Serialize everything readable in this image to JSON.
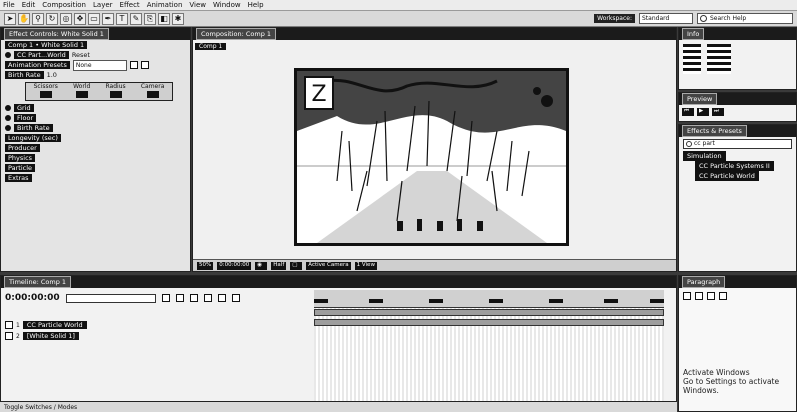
{
  "menu": [
    "File",
    "Edit",
    "Composition",
    "Layer",
    "Effect",
    "Animation",
    "View",
    "Window",
    "Help"
  ],
  "toolbar": {
    "workspace_label": "Workspace:",
    "workspace_value": "Standard",
    "search_placeholder": "Search Help"
  },
  "effects_panel": {
    "tab_label": "Effect Controls: White Solid 1",
    "breadcrumb": "Comp 1 • White Solid 1",
    "effect_name": "CC Part...World",
    "rows": [
      {
        "label": "Animation Presets",
        "value": "None"
      },
      {
        "label": "Birth Rate",
        "value": "1.0"
      }
    ],
    "params": [
      {
        "label": "Scissors"
      },
      {
        "label": "World"
      },
      {
        "label": "Radius"
      },
      {
        "label": "Camera"
      }
    ],
    "sections": [
      "Grid",
      "Floor",
      "Birth Rate",
      "Longevity (sec)",
      "Producer",
      "Physics",
      "Particle",
      "Extras"
    ]
  },
  "viewer": {
    "tab_label": "Composition: Comp 1",
    "sub_tab": "Comp 1",
    "zoom": "50%",
    "timecode": "0:00:00:00",
    "resolution": "Half",
    "camera": "Active Camera",
    "views": "1 View"
  },
  "info_panel": {
    "tab_label": "Info"
  },
  "preview_panel": {
    "tab_label": "Preview"
  },
  "effects_presets": {
    "tab_label": "Effects & Presets",
    "search_value": "cc part",
    "category": "Simulation",
    "items": [
      "CC Particle Systems II",
      "CC Particle World"
    ]
  },
  "paragraph_panel": {
    "tab_label": "Paragraph",
    "watermark_line1": "Activate Windows",
    "watermark_line2": "Go to Settings to activate Windows."
  },
  "timeline": {
    "tab_label": "Timeline: Comp 1",
    "timecode": "0:00:00:00",
    "layers": [
      {
        "num": "1",
        "name": "CC Particle World",
        "highlight": true
      },
      {
        "num": "2",
        "name": "[White Solid 1]",
        "highlight": false
      }
    ]
  },
  "statusbar": {
    "left": "Toggle Switches / Modes"
  }
}
